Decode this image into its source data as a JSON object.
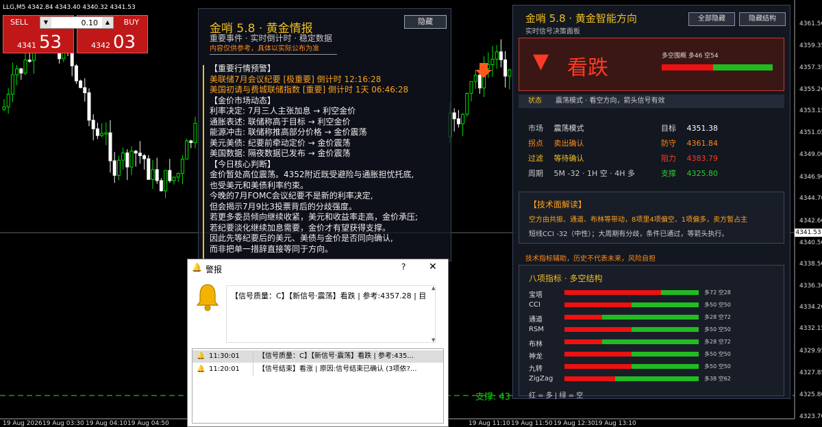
{
  "chart": {
    "symbol_info": "LLG,M5  4342.84 4343.40 4340.32 4341.53",
    "price_labels": [
      "4361.50",
      "4359.35",
      "4357.35",
      "4355.20",
      "4353.15",
      "4351.05",
      "4349.00",
      "4346.90",
      "4344.70",
      "4342.60",
      "4341.53",
      "4340.50",
      "4338.50",
      "4336.30",
      "4334.20",
      "4332.15",
      "4329.95",
      "4327.85",
      "4325.80",
      "4323.70"
    ],
    "current_price": "4341.53",
    "time_labels": [
      "19 Aug 2026",
      "19 Aug 03:30",
      "19 Aug 04:10",
      "19 Aug 04:50",
      "19 Aug 11:10",
      "19 Aug 11:50",
      "19 Aug 12:30",
      "19 Aug 13:10"
    ],
    "support_text": "支撑: 43",
    "colors": {
      "bull": "#00e400",
      "bear": "#ffffff",
      "support_line": "#12c012",
      "arrow": "#ff5a1c"
    }
  },
  "one_click": {
    "sell_label": "SELL",
    "buy_label": "BUY",
    "lot_value": "0.10",
    "sell_small": "4341",
    "sell_big": "53",
    "buy_small": "4342",
    "buy_big": "03"
  },
  "info_panel": {
    "title": "金哨 5.8 · 黄金情报",
    "subtitle": "重要事件 · 实时倒计时 · 稳定数据",
    "disclaimer": "内容仅供参考，具体以实际公布为准",
    "hide_label": "隐藏",
    "lines": [
      {
        "text": "【重要行情预警】",
        "cls": "c-white"
      },
      {
        "text": "美联储7月会议纪要 [极重要] 倒计时 12:16:28",
        "cls": "c-orange"
      },
      {
        "text": "美国初请与费城联储指数 [重要] 倒计时 1天 06:46:28",
        "cls": "c-orange"
      },
      {
        "text": "【金价市场动态】",
        "cls": "c-white"
      },
      {
        "text": "利率决定: 7月三人主张加息  →    利空金价",
        "cls": "c-white"
      },
      {
        "text": "通胀表述: 联储称高于目标  →    利空金价",
        "cls": "c-white"
      },
      {
        "text": "能源冲击: 联储称推高部分价格  →    金价震荡",
        "cls": "c-white"
      },
      {
        "text": "美元美债: 纪要前牵动定价  →    金价震荡",
        "cls": "c-white"
      },
      {
        "text": "美国数据: 隔夜数据已发布  →    金价震荡",
        "cls": "c-white"
      },
      {
        "text": "【今日核心判断】",
        "cls": "c-white"
      },
      {
        "text": "金价暂处高位震荡。4352附近既受避险与通胀担忧托底,",
        "cls": "c-white"
      },
      {
        "text": "也受美元和美债利率约束。",
        "cls": "c-white"
      },
      {
        "text": "今晚的7月FOMC会议纪要不是新的利率决定,",
        "cls": "c-white"
      },
      {
        "text": "但会揭示7月9比3投票背后的分歧强度。",
        "cls": "c-white"
      },
      {
        "text": "若更多委员倾向继续收紧，美元和收益率走高，金价承压;",
        "cls": "c-white"
      },
      {
        "text": "若纪要淡化继续加息需要，金价才有望获得支撑。",
        "cls": "c-white"
      },
      {
        "text": "因此先等纪要后的美元、美债与金价是否同向确认,",
        "cls": "c-white"
      },
      {
        "text": "而非把单一措辞直接等同于方向。",
        "cls": "c-white"
      }
    ]
  },
  "right_panel": {
    "title": "金哨 5.8 · 黄金智能方向",
    "subtitle": "实时信号决策面板",
    "hide_all_label": "全部隐藏",
    "hide_struct_label": "隐藏结构",
    "signal": "看跌",
    "signal_arrow": "▼",
    "bull_bear_text": "多空围概  多46 空54",
    "bull_pct": 46,
    "state_key": "状态",
    "state_value": "震荡模式 · 看空方向，箭头信号有效",
    "market_key": "市场",
    "market_value": "震荡模式",
    "turn_key": "拐点",
    "turn_value": "卖出确认",
    "filter_key": "过滤",
    "filter_value": "等待确认",
    "period_key": "周期",
    "period_value": "5M -32 · 1H 空 · 4H 多",
    "target_key": "目标",
    "target_value": "4351.38",
    "defend_key": "防守",
    "defend_value": "4361.84",
    "resist_key": "阻力",
    "resist_value": "4383.79",
    "support_key": "支撑",
    "support_value": "4325.80",
    "tech_header": "【技术面解读】",
    "tech_line1": "空方由共振、通道、布林等带动，8项里4项偏空、1项偏多，卖方暂占主",
    "tech_line2": "短线CCI -32（中性）；大周期有分歧，条件已通过，等箭头执行。",
    "aux_note": "技术指标辅助，历史不代表未来，风险自担",
    "ind_header": "八项指标 · 多空结构",
    "indicators": [
      {
        "name": "宝塔",
        "bull": 72,
        "label": "多72 空28"
      },
      {
        "name": "CCI",
        "bull": 50,
        "label": "多50 空50"
      },
      {
        "name": "通道",
        "bull": 28,
        "label": "多28 空72"
      },
      {
        "name": "RSM",
        "bull": 50,
        "label": "多50 空50"
      },
      {
        "name": "布林",
        "bull": 28,
        "label": "多28 空72"
      },
      {
        "name": "神龙",
        "bull": 50,
        "label": "多50 空50"
      },
      {
        "name": "九转",
        "bull": 50,
        "label": "多50 空50"
      },
      {
        "name": "ZigZag",
        "bull": 38,
        "label": "多38 空62"
      }
    ],
    "legend": "红 = 多  |  绿 = 空",
    "colors": {
      "red": "#ee1111",
      "green": "#22bb22",
      "gold": "#f0c020"
    }
  },
  "alert": {
    "title": "警报",
    "help": "?",
    "message": "【信号质量：C】【新信号·震荡】看跌 | 参考:4357.28 | 目",
    "rows": [
      {
        "time": "11:30:01",
        "text": "【信号质量：C】【新信号·震荡】看跌 | 参考:435..."
      },
      {
        "time": "11:20:01",
        "text": "【信号结束】看涨 | 原因:信号结束已确认 (3项依?..."
      }
    ]
  }
}
